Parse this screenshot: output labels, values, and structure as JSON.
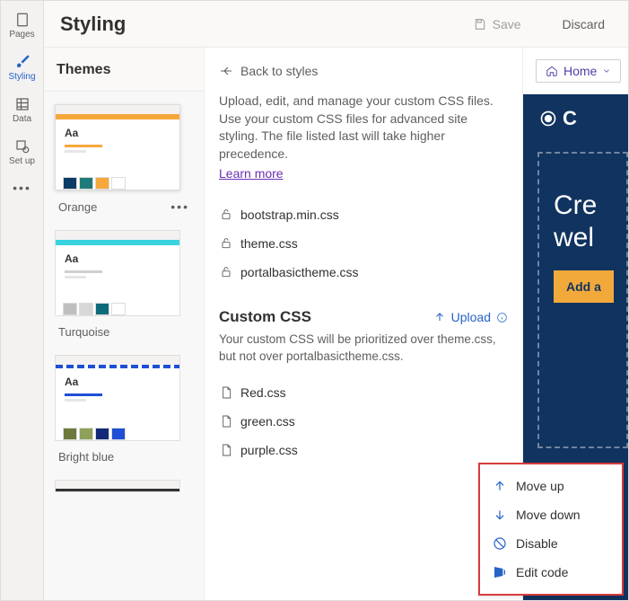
{
  "rail": {
    "items": [
      {
        "label": "Pages"
      },
      {
        "label": "Styling"
      },
      {
        "label": "Data"
      },
      {
        "label": "Set up"
      }
    ]
  },
  "toolbar": {
    "title": "Styling",
    "save_label": "Save",
    "discard_label": "Discard"
  },
  "themes_header": "Themes",
  "themes": [
    {
      "name": "Orange",
      "accent": "#f7a83b",
      "line_color": "#f7a83b",
      "swatches": [
        "#0b3c66",
        "#1f7a7a",
        "#f7a83b",
        "#ffffff"
      ],
      "selected": true,
      "more": true
    },
    {
      "name": "Turquoise",
      "accent": "#39d3e0",
      "line_color": "#cfcfcf",
      "swatches": [
        "#bfbfbf",
        "#d7d7d7",
        "#0d6a7a",
        "#ffffff"
      ],
      "selected": false,
      "more": false
    },
    {
      "name": "Bright blue",
      "accent": "#1f4fd6",
      "line_color": "#1f4fd6",
      "swatches": [
        "#6c7a3e",
        "#8fa05a",
        "#12297a",
        "#1f4fd6"
      ],
      "selected": false,
      "more": false,
      "dashed_accent": true
    }
  ],
  "aa_label": "Aa",
  "back_label": "Back to styles",
  "description": "Upload, edit, and manage your custom CSS files. Use your custom CSS files for advanced site styling. The file listed last will take higher precedence.",
  "learn_more": "Learn more",
  "system_files": [
    "bootstrap.min.css",
    "theme.css",
    "portalbasictheme.css"
  ],
  "custom_section": {
    "title": "Custom CSS",
    "upload_label": "Upload",
    "note": "Your custom CSS will be prioritized over theme.css, but not over portalbasictheme.css.",
    "files": [
      "Red.css",
      "green.css",
      "purple.css"
    ]
  },
  "preview": {
    "home_label": "Home",
    "brand_initial": "C",
    "hero_line1": "Cre",
    "hero_line2": "wel",
    "cta": "Add a"
  },
  "context_menu": [
    "Move up",
    "Move down",
    "Disable",
    "Edit code"
  ]
}
